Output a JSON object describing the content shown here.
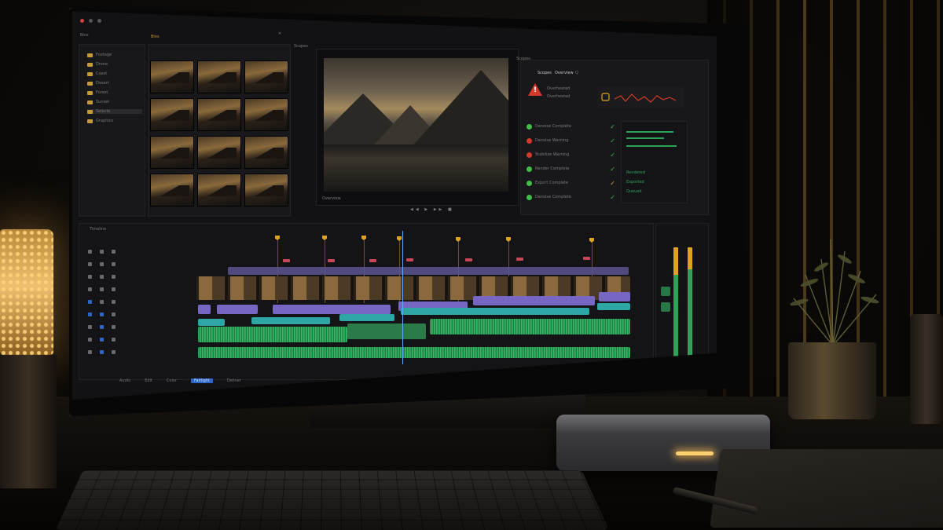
{
  "app": {
    "panel_titles": {
      "media": "Bins",
      "inspector": "Scopes",
      "timeline": "Timeline",
      "viewer_timecode": "Overview"
    },
    "bins": [
      {
        "label": "Footage"
      },
      {
        "label": "Drone"
      },
      {
        "label": "Coast"
      },
      {
        "label": "Desert"
      },
      {
        "label": "Forest"
      },
      {
        "label": "Sunset"
      },
      {
        "label": "Selects"
      },
      {
        "label": "Graphics"
      }
    ],
    "inspector_header": {
      "tab1": "Scopes",
      "tab2": "Overview",
      "tab3": "Q"
    },
    "warning": {
      "title": "Overheated",
      "subtitle": "Overheated"
    },
    "checks": [
      {
        "label": "Denoise Complete",
        "status": "ok"
      },
      {
        "label": "Denoise Warning",
        "status": "error"
      },
      {
        "label": "Stabilize Warning",
        "status": "error"
      },
      {
        "label": "Render Complete",
        "status": "ok"
      },
      {
        "label": "Export Complete",
        "status": "warn"
      },
      {
        "label": "Denoise Complete",
        "status": "ok"
      }
    ],
    "meter_labels": [
      "Rendered",
      "Exported",
      "Queued"
    ],
    "timeline_controls": [
      "Audio",
      "Edit",
      "Color",
      "Fairlight",
      "Deliver"
    ],
    "colors": {
      "accent_blue": "#2c66c8",
      "marker_yellow": "#e0a320",
      "clip_purple": "#7766c4",
      "clip_teal": "#2fa6a6",
      "audio_green": "#2fa25a",
      "error_red": "#d33a2c",
      "ok_green": "#3fbf4a"
    }
  }
}
